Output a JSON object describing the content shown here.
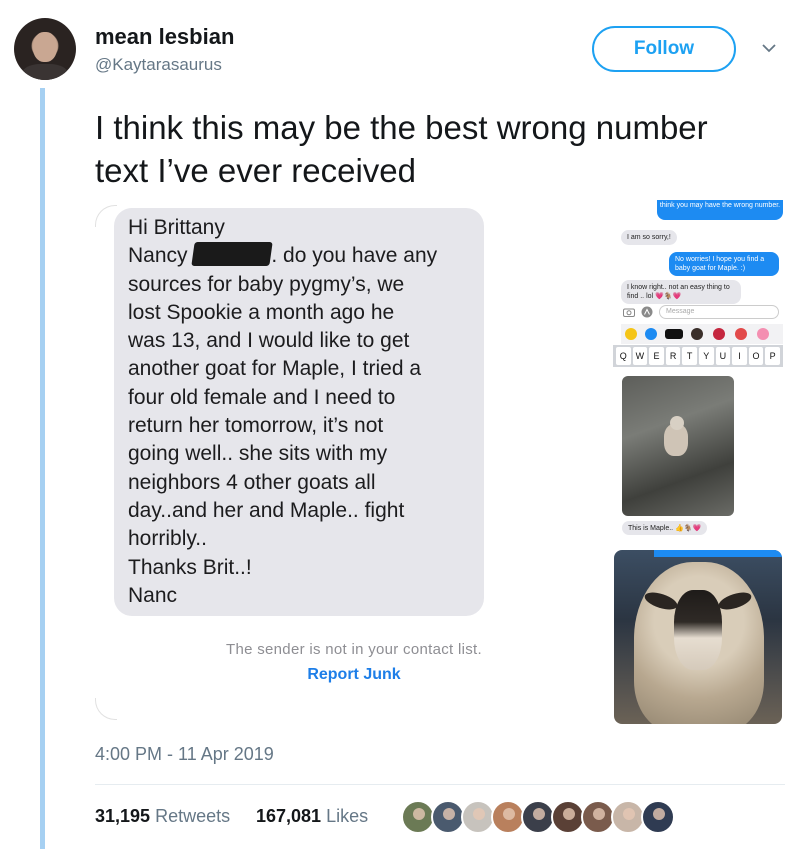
{
  "author": {
    "display_name": "mean lesbian",
    "handle": "@Kaytarasaurus"
  },
  "follow_label": "Follow",
  "tweet_text": "I think this may be the best wrong number text I’ve ever received",
  "sms": {
    "lines": [
      "Hi Brittany",
      "Nancy ",
      "sources for baby pygmy’s, we",
      "lost Spookie a month ago he",
      "was 13, and I would like to get",
      "another goat for Maple, I tried a",
      "four old female and I need to",
      "return her tomorrow, it’s not",
      "going well.. she sits with my",
      "neighbors 4 other goats all",
      "day..and her and Maple.. fight",
      "horribly..",
      "Thanks Brit..!",
      "Nanc"
    ],
    "line2_suffix": ". do you have any",
    "sender_note": "The sender is not in your contact list.",
    "report_junk": "Report Junk"
  },
  "phone_shot": {
    "top_bubble": "think you may have the wrong number.",
    "reply1": "I am so sorry,!",
    "reply2": "No worries! I hope you find a baby goat for Maple. :)",
    "reply3": "I know right.. not an easy thing to find .. lol 💗🐐💗",
    "input_placeholder": "Message",
    "keys": [
      "Q",
      "W",
      "E",
      "R",
      "T",
      "Y",
      "U",
      "I",
      "O",
      "P"
    ],
    "caption": "This is Maple.. 👍🐐💗"
  },
  "timestamp": "4:00 PM - 11 Apr 2019",
  "stats": {
    "retweets_count": "31,195",
    "retweets_label": "Retweets",
    "likes_count": "167,081",
    "likes_label": "Likes"
  },
  "likers": [
    "#6b7a55",
    "#4a5a6e",
    "#c7c3bd",
    "#b9805d",
    "#3b3f4a",
    "#5a4036",
    "#7a5b4c",
    "#c8b6a8",
    "#2f3b52"
  ]
}
